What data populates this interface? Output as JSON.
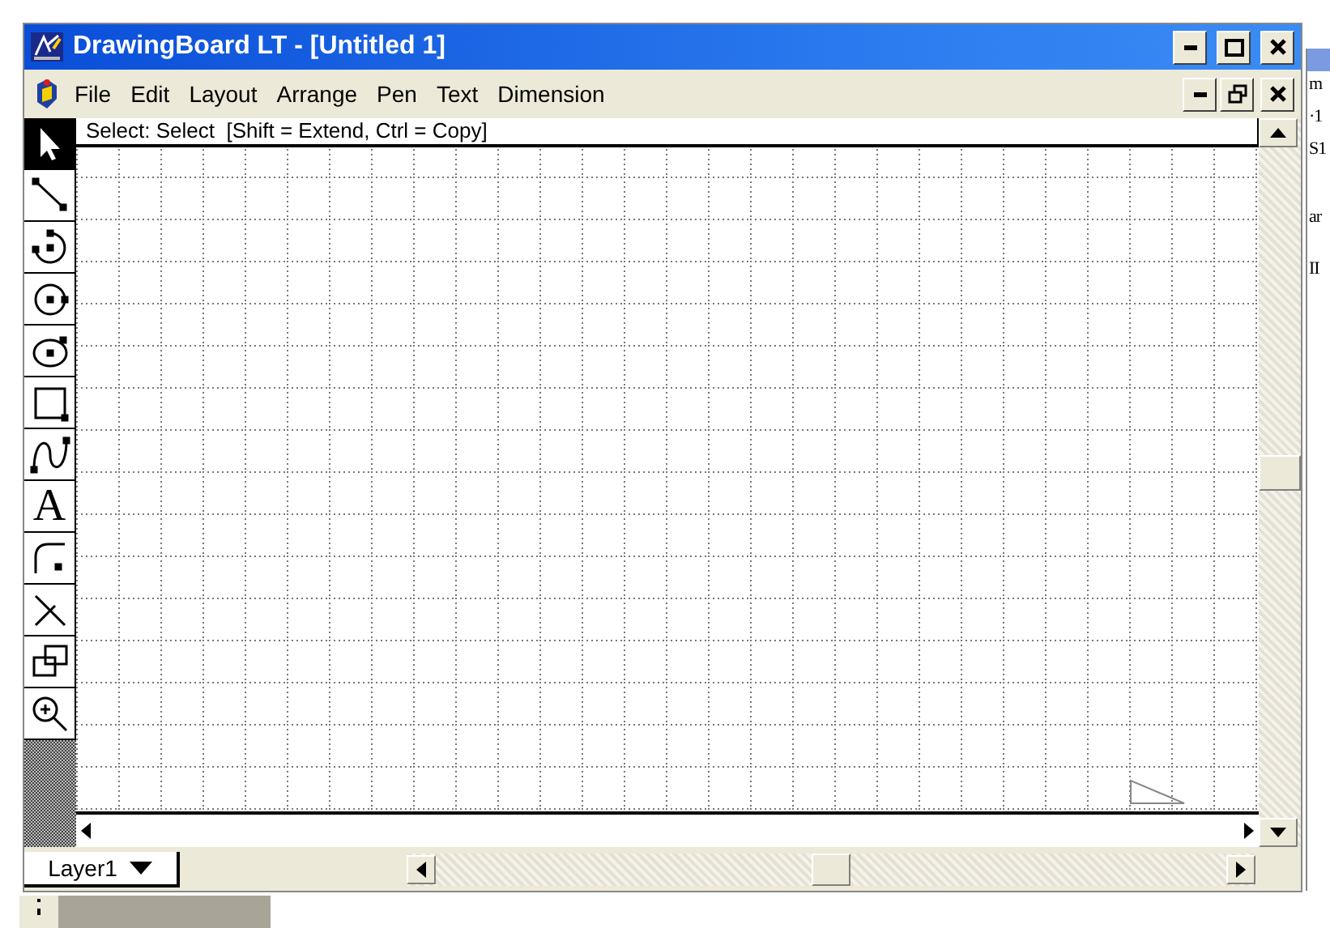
{
  "window": {
    "title": "DrawingBoard LT - [Untitled 1]"
  },
  "menu": [
    "File",
    "Edit",
    "Layout",
    "Arrange",
    "Pen",
    "Text",
    "Dimension"
  ],
  "prompt": "Select: Select  [Shift = Extend, Ctrl = Copy]",
  "tools": [
    {
      "kind": "select",
      "selected": true
    },
    {
      "kind": "line",
      "selected": false
    },
    {
      "kind": "arc",
      "selected": false
    },
    {
      "kind": "circle",
      "selected": false
    },
    {
      "kind": "ellipse",
      "selected": false
    },
    {
      "kind": "rectangle",
      "selected": false
    },
    {
      "kind": "curve",
      "selected": false
    },
    {
      "kind": "text",
      "glyph": "A",
      "selected": false
    },
    {
      "kind": "fillet",
      "selected": false
    },
    {
      "kind": "trim",
      "selected": false
    },
    {
      "kind": "group",
      "selected": false
    },
    {
      "kind": "zoom",
      "selected": false
    }
  ],
  "layer": "Layer1",
  "behind": [
    "m",
    "·1",
    "S1",
    "ar",
    "II"
  ]
}
